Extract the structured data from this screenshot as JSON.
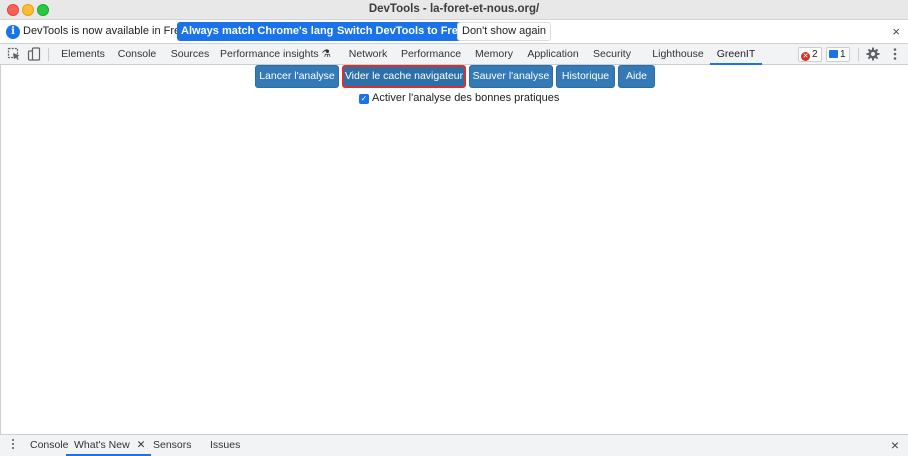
{
  "window": {
    "title": "DevTools - la-foret-et-nous.org/"
  },
  "infobar": {
    "message": "DevTools is now available in French!",
    "buttons": [
      "Always match Chrome's language",
      "Switch DevTools to French",
      "Don't show again"
    ],
    "close": "×"
  },
  "toolbar": {
    "tabs": [
      "Elements",
      "Console",
      "Sources",
      "Performance insights ⚗",
      "Network",
      "Performance",
      "Memory",
      "Application",
      "Security",
      "Lighthouse",
      "GreenIT"
    ],
    "active_tab": "GreenIT",
    "errors_count": "2",
    "messages_count": "1"
  },
  "greenit": {
    "buttons": [
      "Lancer l'analyse",
      "Vider le cache navigateur",
      "Sauver l'analyse",
      "Historique",
      "Aide"
    ],
    "checkbox_label": "Activer l'analyse des bonnes pratiques",
    "checkbox_checked": true
  },
  "drawer": {
    "tabs": [
      "Console",
      "What's New",
      "Sensors",
      "Issues"
    ],
    "active_tab": "What's New",
    "close": "×"
  },
  "colors": {
    "accent": "#1a73e8",
    "greenit_button": "#337ab7",
    "focus_outline": "#d9302c"
  }
}
